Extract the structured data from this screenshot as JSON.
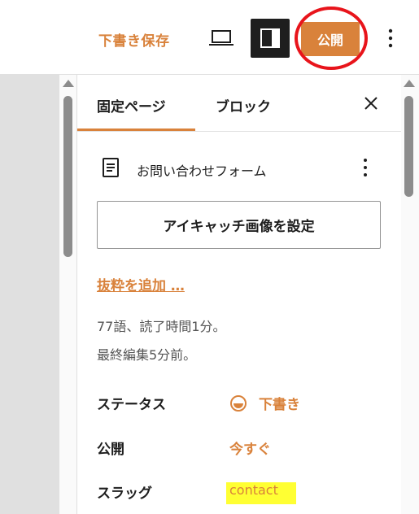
{
  "header": {
    "save_draft_label": "下書き保存",
    "publish_label": "公開",
    "preview_icon": "laptop-icon",
    "settings_icon": "sidebar-toggle-icon",
    "more_icon": "vertical-ellipsis-icon",
    "accent_color": "#d9823b",
    "highlight_color": "#e8141b"
  },
  "sidebar": {
    "tabs": [
      {
        "label": "固定ページ",
        "active": true
      },
      {
        "label": "ブロック",
        "active": false
      }
    ],
    "close_icon": "close-icon",
    "post": {
      "icon": "document-icon",
      "title": "お問い合わせフォーム"
    },
    "featured_image_label": "アイキャッチ画像を設定",
    "excerpt_link": "抜粋を追加 …",
    "meta": {
      "word_count": "77語、読了時間1分。",
      "last_edited": "最終編集5分前。"
    },
    "rows": {
      "status_label": "ステータス",
      "status_value": "下書き",
      "publish_label": "公開",
      "publish_value": "今すぐ",
      "slug_label": "スラッグ",
      "slug_value": "contact"
    }
  }
}
